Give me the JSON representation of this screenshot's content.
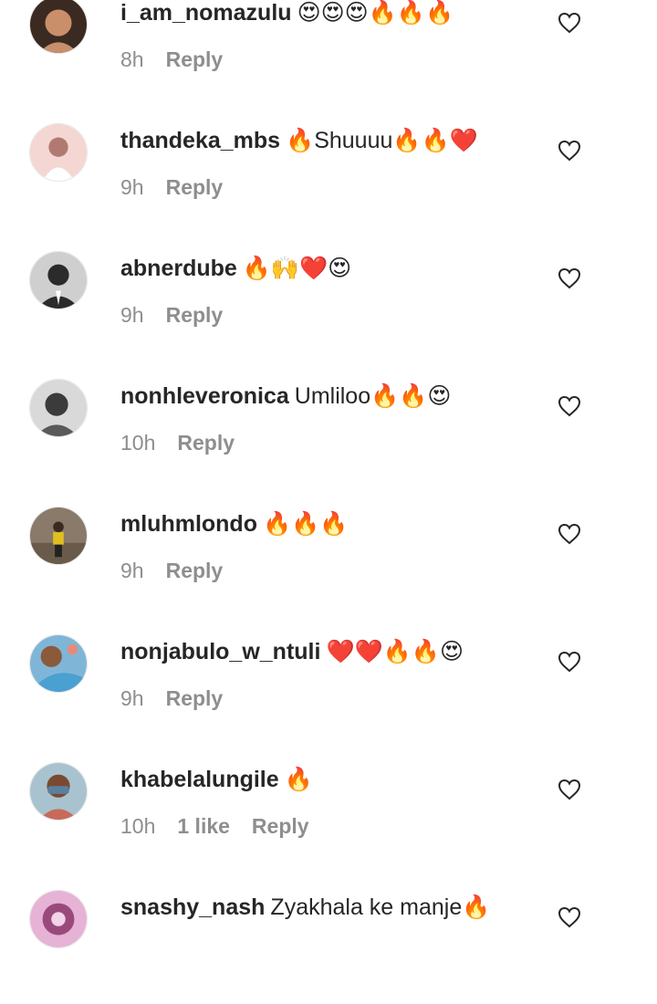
{
  "comments": [
    {
      "username": "i_am_nomazulu",
      "text": "😍😍😍🔥🔥🔥",
      "time": "8h",
      "likes": "",
      "reply": "Reply",
      "avatar_colors": [
        "#3a2a22",
        "#c98f6a"
      ]
    },
    {
      "username": "thandeka_mbs",
      "text": "🔥Shuuuu🔥🔥❤️",
      "time": "9h",
      "likes": "",
      "reply": "Reply",
      "avatar_colors": [
        "#f4d7d2",
        "#b07a72"
      ]
    },
    {
      "username": "abnerdube",
      "text": "🔥🙌❤️😍",
      "time": "9h",
      "likes": "",
      "reply": "Reply",
      "avatar_colors": [
        "#cfcfcf",
        "#2b2b2b"
      ]
    },
    {
      "username": "nonhleveronica",
      "text": "Umliloo🔥🔥😍",
      "time": "10h",
      "likes": "",
      "reply": "Reply",
      "avatar_colors": [
        "#d9d9d9",
        "#3b3b3b"
      ]
    },
    {
      "username": "mluhmlondo",
      "text": "🔥🔥🔥",
      "time": "9h",
      "likes": "",
      "reply": "Reply",
      "avatar_colors": [
        "#7a6a5a",
        "#e0c020"
      ]
    },
    {
      "username": "nonjabulo_w_ntuli",
      "text": "❤️❤️🔥🔥😍",
      "time": "9h",
      "likes": "",
      "reply": "Reply",
      "avatar_colors": [
        "#7fb6d8",
        "#e88a7a"
      ]
    },
    {
      "username": "khabelalungile",
      "text": "🔥",
      "time": "10h",
      "likes": "1 like",
      "reply": "Reply",
      "avatar_colors": [
        "#a9c2cf",
        "#5b7fa0"
      ]
    },
    {
      "username": "snashy_nash",
      "text": "Zyakhala ke manje🔥",
      "time": "",
      "likes": "",
      "reply": "",
      "avatar_colors": [
        "#e6b2d6",
        "#9a4a7a"
      ]
    }
  ]
}
